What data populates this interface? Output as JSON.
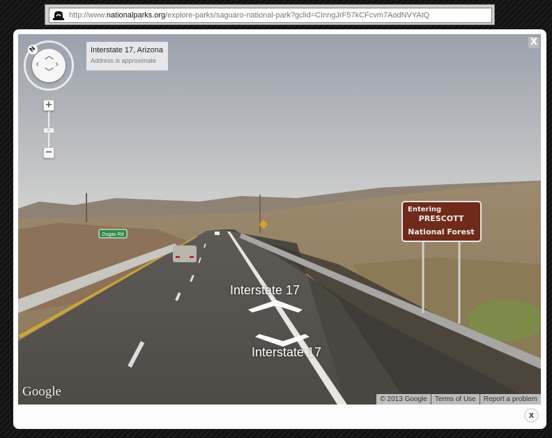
{
  "browser": {
    "url_prefix": "http://www.",
    "url_domain": "nationalparks.org",
    "url_path": "/explore-parks/saguaro-national-park?gclid=CInngJrF57kCFcvm7AodNVYAtQ",
    "icon": "lock-icon"
  },
  "streetview": {
    "address_line": "Interstate 17, Arizona",
    "address_note": "Address is approximate",
    "compass_north_label": "N",
    "zoom_in_label": "+",
    "zoom_out_label": "−",
    "zoom_level_handle": "−",
    "close_label": "X",
    "nav_forward_label": "Interstate 17",
    "nav_backward_label": "Interstate 17",
    "logo": "Google",
    "footer": {
      "copyright": "© 2013 Google",
      "terms": "Terms of Use",
      "report": "Report a problem"
    },
    "scene_signs": {
      "forest_sign": [
        "Entering",
        "PRESCOTT",
        "National Forest"
      ],
      "road_sign": "Dugas Rd"
    }
  },
  "popup": {
    "close_label": "x"
  }
}
